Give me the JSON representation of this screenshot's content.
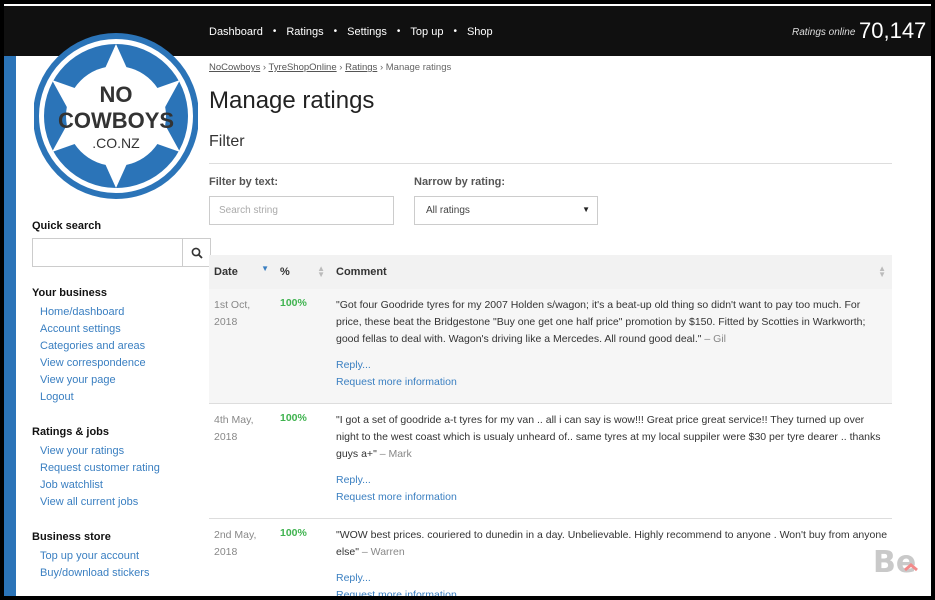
{
  "nav": {
    "items": [
      "Dashboard",
      "Ratings",
      "Settings",
      "Top up",
      "Shop"
    ],
    "ratings_online_label": "Ratings online",
    "ratings_online_count": "70,147"
  },
  "logo": {
    "line1": "NO",
    "line2": "COWBOYS",
    "line3": ".CO.NZ"
  },
  "sidebar": {
    "quick_search_heading": "Quick search",
    "search_value": "",
    "groups": [
      {
        "heading": "Your business",
        "items": [
          "Home/dashboard",
          "Account settings",
          "Categories and areas",
          "View correspondence",
          "View your page",
          "Logout"
        ]
      },
      {
        "heading": "Ratings & jobs",
        "items": [
          "View your ratings",
          "Request customer rating",
          "Job watchlist",
          "View all current jobs"
        ]
      },
      {
        "heading": "Business store",
        "items": [
          "Top up your account",
          "Buy/download stickers"
        ]
      }
    ]
  },
  "breadcrumb": [
    "NoCowboys",
    "TyreShopOnline",
    "Ratings",
    "Manage ratings"
  ],
  "page_title": "Manage ratings",
  "filter": {
    "title": "Filter",
    "text_label": "Filter by text:",
    "text_placeholder": "Search string",
    "rating_label": "Narrow by rating:",
    "rating_selected": "All ratings"
  },
  "table": {
    "headers": [
      "Date",
      "%",
      "Comment"
    ],
    "rows": [
      {
        "date": "1st Oct, 2018",
        "percent": "100%",
        "comment": "\"Got four Goodride tyres for my 2007 Holden s/wagon; it's a beat-up old thing so didn't want to pay too much. For price, these beat the Bridgestone \"Buy one get one half price\" promotion by $150. Fitted by Scotties in Warkworth; good fellas to deal with. Wagon's driving like a Mercedes. All round good deal.\"",
        "author": "– Gil",
        "reply": "Reply...",
        "request": "Request more information"
      },
      {
        "date": "4th May, 2018",
        "percent": "100%",
        "comment": "\"I got a set of goodride a-t tyres for my van .. all i can say is wow!!! Great price great service!! They turned up over night to the west coast which is usualy unheard of.. same tyres at my local suppiler were $30 per tyre dearer .. thanks guys a+\"",
        "author": "– Mark",
        "reply": "Reply...",
        "request": "Request more information"
      },
      {
        "date": "2nd May, 2018",
        "percent": "100%",
        "comment": "\"WOW best prices. couriered to dunedin in a day. Unbelievable. Highly recommend to anyone . Won't buy from anyone else\"",
        "author": "– Warren",
        "reply": "Reply...",
        "request": "Request more information"
      }
    ]
  },
  "watermark": "Be",
  "colors": {
    "nav_bg": "#101010",
    "brand_blue": "#2b74b8",
    "link": "#3a7fc1",
    "percent_green": "#3fb34f"
  }
}
